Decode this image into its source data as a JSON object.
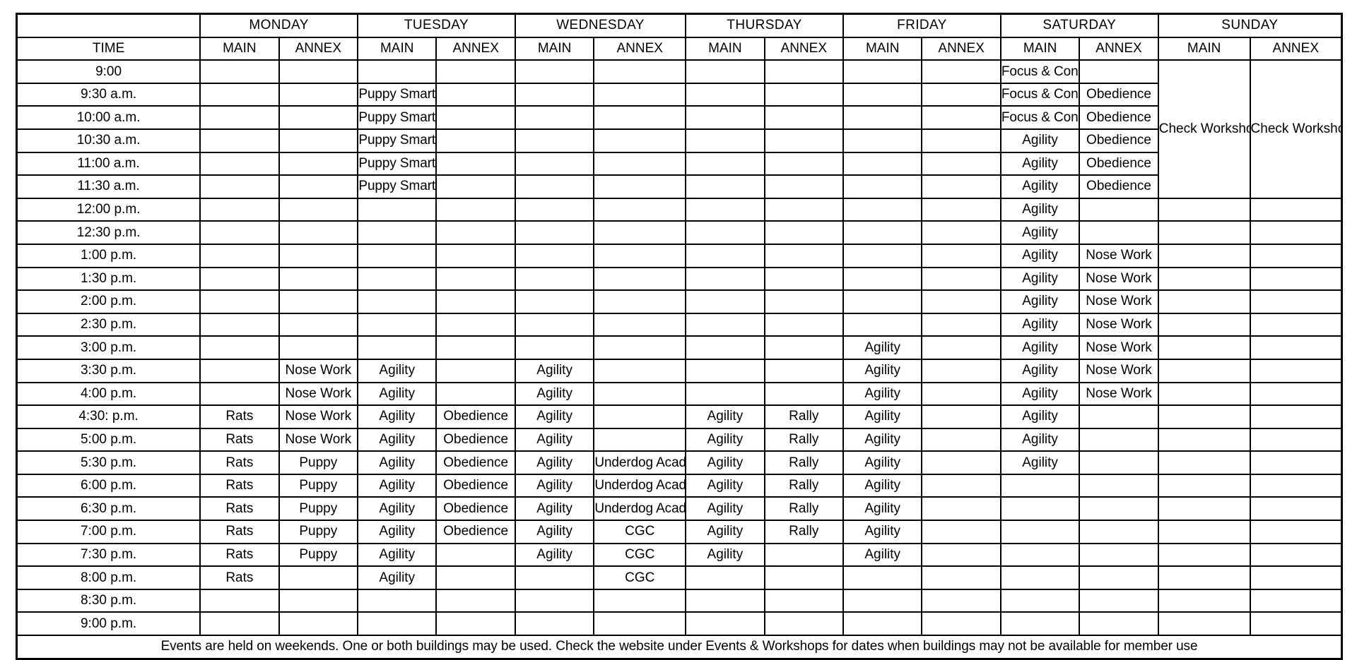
{
  "colors": {
    "accent": "#2fded2",
    "grid": "#000000",
    "cell_background": "#ffffff"
  },
  "header": {
    "corner_label": "",
    "time_column_label": "TIME",
    "days": [
      "MONDAY",
      "TUESDAY",
      "WEDNESDAY",
      "THURSDAY",
      "FRIDAY",
      "SATURDAY",
      "SUNDAY"
    ],
    "building_labels": [
      "MAIN",
      "ANNEX"
    ]
  },
  "footer": {
    "note": "Events are held on weekends. One or both buildings may be used. Check the website under Events & Workshops for dates when buildings may not be available for member use"
  },
  "sunday_note": {
    "main": "Check Workshops & Events for Scheduled Use",
    "annex": "Check Workshops & Events for Scheduled Use",
    "rowspan": 6
  },
  "schedule": {
    "times": [
      "9:00",
      "9:30 a.m.",
      "10:00 a.m.",
      "10:30 a.m.",
      "11:00 a.m.",
      "11:30 a.m.",
      "12:00 p.m.",
      "12:30 p.m.",
      "1:00 p.m.",
      "1:30 p.m.",
      "2:00 p.m.",
      "2:30 p.m.",
      "3:00 p.m.",
      "3:30 p.m.",
      "4:00 p.m.",
      "4:30: p.m.",
      "5:00 p.m.",
      "5:30 p.m.",
      "6:00 p.m.",
      "6:30 p.m.",
      "7:00 p.m.",
      "7:30 p.m.",
      "8:00 p.m.",
      "8:30 p.m.",
      "9:00 p.m."
    ],
    "rows": [
      {
        "time": "9:00",
        "cells": [
          "",
          "",
          "",
          "",
          "",
          "",
          "",
          "",
          "",
          "",
          "Focus & Control",
          "",
          "SUNDAY_MERGE",
          "SUNDAY_MERGE"
        ]
      },
      {
        "time": "9:30 a.m.",
        "cells": [
          "",
          "",
          "Puppy Smart",
          "",
          "",
          "",
          "",
          "",
          "",
          "",
          "Focus & Control",
          "Obedience",
          "",
          ""
        ]
      },
      {
        "time": "10:00 a.m.",
        "cells": [
          "",
          "",
          "Puppy Smart",
          "",
          "",
          "",
          "",
          "",
          "",
          "",
          "Focus & Control",
          "Obedience",
          "",
          ""
        ]
      },
      {
        "time": "10:30 a.m.",
        "cells": [
          "",
          "",
          "Puppy Smart",
          "",
          "",
          "",
          "",
          "",
          "",
          "",
          "Agility",
          "Obedience",
          "",
          ""
        ]
      },
      {
        "time": "11:00 a.m.",
        "cells": [
          "",
          "",
          "Puppy Smart",
          "",
          "",
          "",
          "",
          "",
          "",
          "",
          "Agility",
          "Obedience",
          "",
          ""
        ]
      },
      {
        "time": "11:30 a.m.",
        "cells": [
          "",
          "",
          "Puppy Smart",
          "",
          "",
          "",
          "",
          "",
          "",
          "",
          "Agility",
          "Obedience",
          "",
          ""
        ]
      },
      {
        "time": "12:00 p.m.",
        "cells": [
          "",
          "",
          "",
          "",
          "",
          "",
          "",
          "",
          "",
          "",
          "Agility",
          "",
          "",
          ""
        ]
      },
      {
        "time": "12:30 p.m.",
        "cells": [
          "",
          "",
          "",
          "",
          "",
          "",
          "",
          "",
          "",
          "",
          "Agility",
          "",
          "",
          ""
        ]
      },
      {
        "time": "1:00 p.m.",
        "cells": [
          "",
          "",
          "",
          "",
          "",
          "",
          "",
          "",
          "",
          "",
          "Agility",
          "Nose Work",
          "",
          ""
        ]
      },
      {
        "time": "1:30 p.m.",
        "cells": [
          "",
          "",
          "",
          "",
          "",
          "",
          "",
          "",
          "",
          "",
          "Agility",
          "Nose Work",
          "",
          ""
        ]
      },
      {
        "time": "2:00 p.m.",
        "cells": [
          "",
          "",
          "",
          "",
          "",
          "",
          "",
          "",
          "",
          "",
          "Agility",
          "Nose Work",
          "",
          ""
        ]
      },
      {
        "time": "2:30 p.m.",
        "cells": [
          "",
          "",
          "",
          "",
          "",
          "",
          "",
          "",
          "",
          "",
          "Agility",
          "Nose Work",
          "",
          ""
        ]
      },
      {
        "time": "3:00 p.m.",
        "cells": [
          "",
          "",
          "",
          "",
          "",
          "",
          "",
          "",
          "Agility",
          "",
          "Agility",
          "Nose Work",
          "",
          ""
        ]
      },
      {
        "time": "3:30 p.m.",
        "cells": [
          "",
          "Nose Work",
          "Agility",
          "",
          "Agility",
          "",
          "",
          "",
          "Agility",
          "",
          "Agility",
          "Nose Work",
          "",
          ""
        ]
      },
      {
        "time": "4:00 p.m.",
        "cells": [
          "",
          "Nose Work",
          "Agility",
          "",
          "Agility",
          "",
          "",
          "",
          "Agility",
          "",
          "Agility",
          "Nose Work",
          "",
          ""
        ]
      },
      {
        "time": "4:30: p.m.",
        "cells": [
          "Rats",
          "Nose Work",
          "Agility",
          "Obedience",
          "Agility",
          "",
          "Agility",
          "Rally",
          "Agility",
          "",
          "Agility",
          "",
          "",
          ""
        ]
      },
      {
        "time": "5:00 p.m.",
        "cells": [
          "Rats",
          "Nose Work",
          "Agility",
          "Obedience",
          "Agility",
          "",
          "Agility",
          "Rally",
          "Agility",
          "",
          "Agility",
          "",
          "",
          ""
        ]
      },
      {
        "time": "5:30 p.m.",
        "cells": [
          "Rats",
          "Puppy",
          "Agility",
          "Obedience",
          "Agility",
          "Underdog Academy",
          "Agility",
          "Rally",
          "Agility",
          "",
          "Agility",
          "",
          "",
          ""
        ]
      },
      {
        "time": "6:00 p.m.",
        "cells": [
          "Rats",
          "Puppy",
          "Agility",
          "Obedience",
          "Agility",
          "Underdog Academy",
          "Agility",
          "Rally",
          "Agility",
          "",
          "",
          "",
          "",
          ""
        ]
      },
      {
        "time": "6:30 p.m.",
        "cells": [
          "Rats",
          "Puppy",
          "Agility",
          "Obedience",
          "Agility",
          "Underdog Academy",
          "Agility",
          "Rally",
          "Agility",
          "",
          "",
          "",
          "",
          ""
        ]
      },
      {
        "time": "7:00 p.m.",
        "cells": [
          "Rats",
          "Puppy",
          "Agility",
          "Obedience",
          "Agility",
          "CGC",
          "Agility",
          "Rally",
          "Agility",
          "",
          "",
          "",
          "",
          ""
        ]
      },
      {
        "time": "7:30 p.m.",
        "cells": [
          "Rats",
          "Puppy",
          "Agility",
          "",
          "Agility",
          "CGC",
          "Agility",
          "",
          "Agility",
          "",
          "",
          "",
          "",
          ""
        ]
      },
      {
        "time": "8:00 p.m.",
        "cells": [
          "Rats",
          "",
          "Agility",
          "",
          "",
          "CGC",
          "",
          "",
          "",
          "",
          "",
          "",
          "",
          ""
        ]
      },
      {
        "time": "8:30 p.m.",
        "cells": [
          "",
          "",
          "",
          "",
          "",
          "",
          "",
          "",
          "",
          "",
          "",
          "",
          "",
          ""
        ]
      },
      {
        "time": "9:00 p.m.",
        "cells": [
          "",
          "",
          "",
          "",
          "",
          "",
          "",
          "",
          "",
          "",
          "",
          "",
          "",
          ""
        ]
      }
    ],
    "small_text_activities": [
      "Puppy Smart",
      "Focus & Control",
      "Underdog Academy"
    ],
    "activity_names": [
      "Rats",
      "Nose Work",
      "Puppy",
      "Puppy Smart",
      "Agility",
      "Obedience",
      "Underdog Academy",
      "CGC",
      "Rally",
      "Focus & Control"
    ]
  }
}
